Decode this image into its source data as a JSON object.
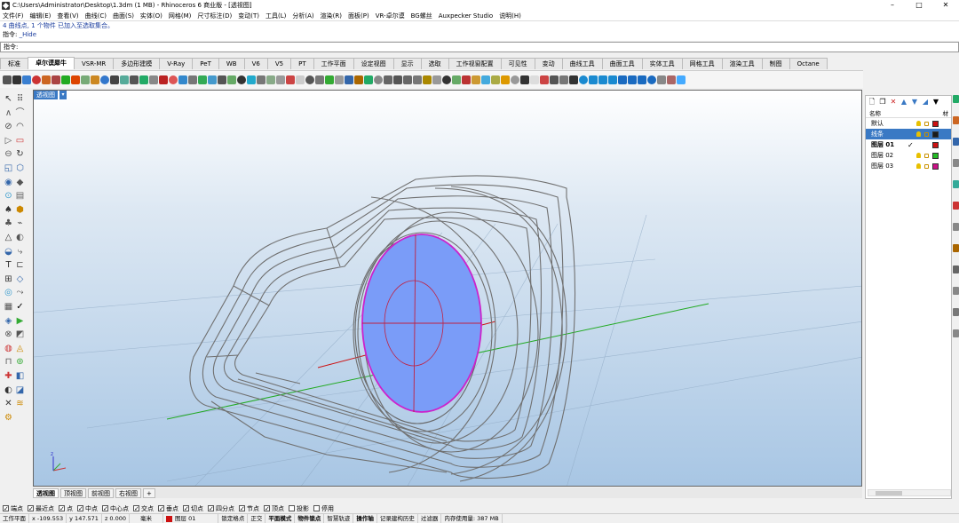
{
  "titlebar": {
    "title": "C:\\Users\\Administrator\\Desktop\\1.3dm (1 MB) - Rhinoceros 6 商业版 - [透视图]",
    "minimize": "–",
    "maximize": "□",
    "close": "✕"
  },
  "menu": [
    "文件(F)",
    "编辑(E)",
    "查看(V)",
    "曲线(C)",
    "曲面(S)",
    "实体(O)",
    "网格(M)",
    "尺寸标注(D)",
    "变动(T)",
    "工具(L)",
    "分析(A)",
    "渲染(R)",
    "面板(P)",
    "VR-卓尔谟",
    "BG螺丝",
    "Auxpecker Studio",
    "说明(H)"
  ],
  "command_history": {
    "line1": "4 曲线点, 1 个物件 已加入至选取集合。",
    "line2_prefix": "指令: ",
    "line2_value": "_Hide"
  },
  "command_prompt": "指令:",
  "tabs": [
    "标准",
    "卓尔谟犀牛",
    "VSR-MR",
    "多边形建模",
    "V-Ray",
    "PeT",
    "WB",
    "V6",
    "V5",
    "PT",
    "工作平面",
    "设定视图",
    "显示",
    "选取",
    "工作视窗配置",
    "可见性",
    "变动",
    "曲线工具",
    "曲面工具",
    "实体工具",
    "网格工具",
    "渲染工具",
    "制图",
    "Octane"
  ],
  "active_tab_index": 1,
  "toolbar_colors": [
    "#555",
    "#333",
    "#3a7fd0",
    "#c33",
    "#c62",
    "#a44",
    "#2a2",
    "#d40",
    "#7a7",
    "#c82",
    "#37c",
    "#444",
    "#5a9",
    "#555",
    "#2a6",
    "#888",
    "#b22",
    "#d55",
    "#38c",
    "#777",
    "#3a5",
    "#49c",
    "#555",
    "#6a6",
    "#333",
    "#2ac",
    "#777",
    "#8a8",
    "#999",
    "#c44",
    "#ccc",
    "#555",
    "#777",
    "#3a3",
    "#999",
    "#36a",
    "#a60",
    "#2a6",
    "#888",
    "#666",
    "#555",
    "#666",
    "#777",
    "#a80",
    "#999",
    "#333",
    "#6a6",
    "#b33",
    "#c93",
    "#4ad",
    "#aa4",
    "#d90",
    "#999",
    "#333",
    "#ddd",
    "#c44",
    "#555",
    "#777",
    "#333",
    "#1a8ad0",
    "#1a8ad0",
    "#1a8ad0",
    "#1a8ad0",
    "#1a6ac0",
    "#1a6ac0",
    "#1a6ac0",
    "#1a6ac0",
    "#888",
    "#a66",
    "#4af"
  ],
  "viewport": {
    "label": "透视图"
  },
  "view_tabs": [
    "透视图",
    "顶视图",
    "前视图",
    "右视图",
    "+"
  ],
  "layers_panel": {
    "header_name": "名称",
    "header_material": "材",
    "layers": [
      {
        "name": "默认",
        "color": "#cc1111",
        "selected": false,
        "current": false
      },
      {
        "name": "线条",
        "color": "#1a1a1a",
        "selected": true,
        "current": false
      },
      {
        "name": "图层 01",
        "color": "#cc1111",
        "selected": false,
        "current": true
      },
      {
        "name": "图层 02",
        "color": "#22bb22",
        "selected": false,
        "current": false
      },
      {
        "name": "图层 03",
        "color": "#cc1188",
        "selected": false,
        "current": false
      }
    ]
  },
  "snaps": [
    {
      "label": "端点",
      "checked": true
    },
    {
      "label": "最近点",
      "checked": true
    },
    {
      "label": "点",
      "checked": true
    },
    {
      "label": "中点",
      "checked": true
    },
    {
      "label": "中心点",
      "checked": true
    },
    {
      "label": "交点",
      "checked": true
    },
    {
      "label": "垂点",
      "checked": true
    },
    {
      "label": "切点",
      "checked": true
    },
    {
      "label": "四分点",
      "checked": true
    },
    {
      "label": "节点",
      "checked": true
    },
    {
      "label": "顶点",
      "checked": true
    },
    {
      "label": "投影",
      "checked": false
    },
    {
      "label": "停用",
      "checked": false
    }
  ],
  "status": {
    "cplane": "工作平面",
    "x": "x -109.553",
    "y": "y 147.571",
    "z": "z 0.000",
    "unit": "毫米",
    "layer": "图层 01",
    "layer_color": "#cc1111",
    "items": [
      "锁定格点",
      "正交",
      "平面模式",
      "物件锁点",
      "智慧轨迹",
      "操作轴",
      "记录建构历史",
      "过滤器",
      "内存使用量: 387 MB"
    ],
    "bold": [
      false,
      false,
      true,
      true,
      false,
      true,
      false,
      false,
      false
    ]
  },
  "colors": {
    "selection": "#3a79c4",
    "surface": "#7a9cf8",
    "curve_highlight": "#cc22cc",
    "grid_x_axis": "#cc1111",
    "grid_y_axis": "#22aa22"
  }
}
